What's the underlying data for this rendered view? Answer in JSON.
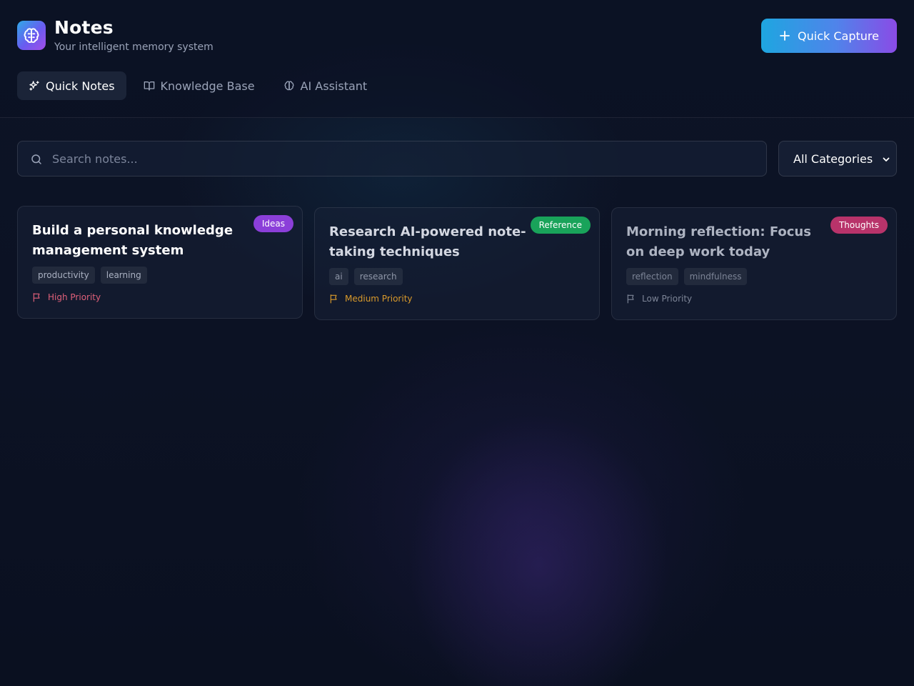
{
  "app": {
    "title": "Notes",
    "subtitle": "Your intelligent memory system",
    "logo_icon": "brain-icon"
  },
  "header": {
    "quick_capture_label": "Quick Capture",
    "quick_capture_icon": "plus-icon"
  },
  "tabs": [
    {
      "label": "Quick Notes",
      "icon": "sparkles-icon",
      "active": true
    },
    {
      "label": "Knowledge Base",
      "icon": "book-open-icon",
      "active": false
    },
    {
      "label": "AI Assistant",
      "icon": "brain-icon",
      "active": false
    }
  ],
  "search": {
    "placeholder": "Search notes...",
    "value": "",
    "icon": "search-icon"
  },
  "category_filter": {
    "selected": "All Categories"
  },
  "notes": [
    {
      "title": "Build a personal knowledge management system",
      "category": "Ideas",
      "category_color": "#8b3fd9",
      "tags": [
        "productivity",
        "learning"
      ],
      "priority": "High Priority",
      "priority_color": "#e0607a"
    },
    {
      "title": "Research AI-powered note-taking techniques",
      "category": "Reference",
      "category_color": "#19a35a",
      "tags": [
        "ai",
        "research"
      ],
      "priority": "Medium Priority",
      "priority_color": "#d99a2b"
    },
    {
      "title": "Morning reflection: Focus on deep work today",
      "category": "Thoughts",
      "category_color": "#b8336a",
      "tags": [
        "reflection",
        "mindfulness"
      ],
      "priority": "Low Priority",
      "priority_color": "#7d8597"
    }
  ],
  "colors": {
    "background": "#0c1224",
    "accent_start": "#1ea6e0",
    "accent_end": "#8a4be6",
    "active_tab": "#1b2438"
  }
}
